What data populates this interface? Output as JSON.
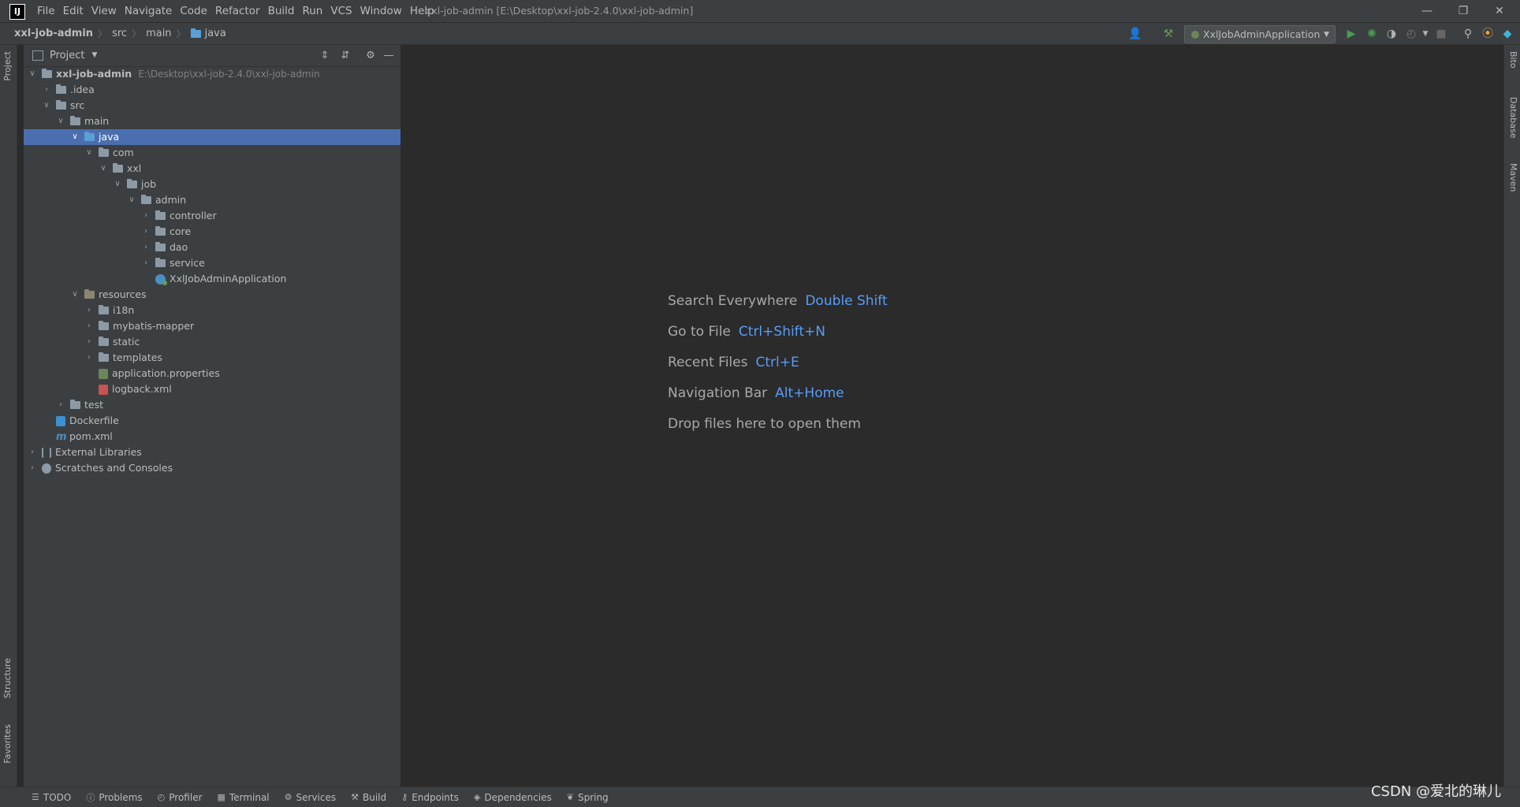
{
  "app": {
    "logo": "IJ",
    "window_title": "xxl-job-admin [E:\\Desktop\\xxl-job-2.4.0\\xxl-job-admin]"
  },
  "menu": [
    "File",
    "Edit",
    "View",
    "Navigate",
    "Code",
    "Refactor",
    "Build",
    "Run",
    "VCS",
    "Window",
    "Help"
  ],
  "breadcrumb": [
    "xxl-job-admin",
    "src",
    "main",
    "java"
  ],
  "toolbar": {
    "run_config": "XxlJobAdminApplication"
  },
  "project_panel": {
    "title": "Project"
  },
  "tree": [
    {
      "label": "xxl-job-admin",
      "hint": "E:\\Desktop\\xxl-job-2.4.0\\xxl-job-admin",
      "expanded": true
    },
    {
      "label": ".idea",
      "expanded": false
    },
    {
      "label": "src",
      "expanded": true
    },
    {
      "label": "main",
      "expanded": true
    },
    {
      "label": "java",
      "expanded": true,
      "selected": true
    },
    {
      "label": "com",
      "expanded": true
    },
    {
      "label": "xxl",
      "expanded": true
    },
    {
      "label": "job",
      "expanded": true
    },
    {
      "label": "admin",
      "expanded": true
    },
    {
      "label": "controller",
      "expanded": false
    },
    {
      "label": "core",
      "expanded": false
    },
    {
      "label": "dao",
      "expanded": false
    },
    {
      "label": "service",
      "expanded": false
    },
    {
      "label": "XxlJobAdminApplication"
    },
    {
      "label": "resources",
      "expanded": true
    },
    {
      "label": "i18n",
      "expanded": false
    },
    {
      "label": "mybatis-mapper",
      "expanded": false
    },
    {
      "label": "static",
      "expanded": false
    },
    {
      "label": "templates",
      "expanded": false
    },
    {
      "label": "application.properties"
    },
    {
      "label": "logback.xml"
    },
    {
      "label": "test",
      "expanded": false
    },
    {
      "label": "Dockerfile"
    },
    {
      "label": "pom.xml"
    },
    {
      "label": "External Libraries",
      "expanded": false
    },
    {
      "label": "Scratches and Consoles",
      "expanded": false
    }
  ],
  "editor_hints": [
    {
      "text": "Search Everywhere",
      "shortcut": "Double Shift"
    },
    {
      "text": "Go to File",
      "shortcut": "Ctrl+Shift+N"
    },
    {
      "text": "Recent Files",
      "shortcut": "Ctrl+E"
    },
    {
      "text": "Navigation Bar",
      "shortcut": "Alt+Home"
    },
    {
      "text": "Drop files here to open them",
      "shortcut": ""
    }
  ],
  "left_tool_windows": [
    "Project",
    "Structure",
    "Favorites"
  ],
  "right_tool_windows": [
    "Bito",
    "Database",
    "Maven"
  ],
  "bottom_tabs": [
    "TODO",
    "Problems",
    "Profiler",
    "Terminal",
    "Services",
    "Build",
    "Endpoints",
    "Dependencies",
    "Spring"
  ],
  "watermark": "CSDN @爱北的琳儿"
}
